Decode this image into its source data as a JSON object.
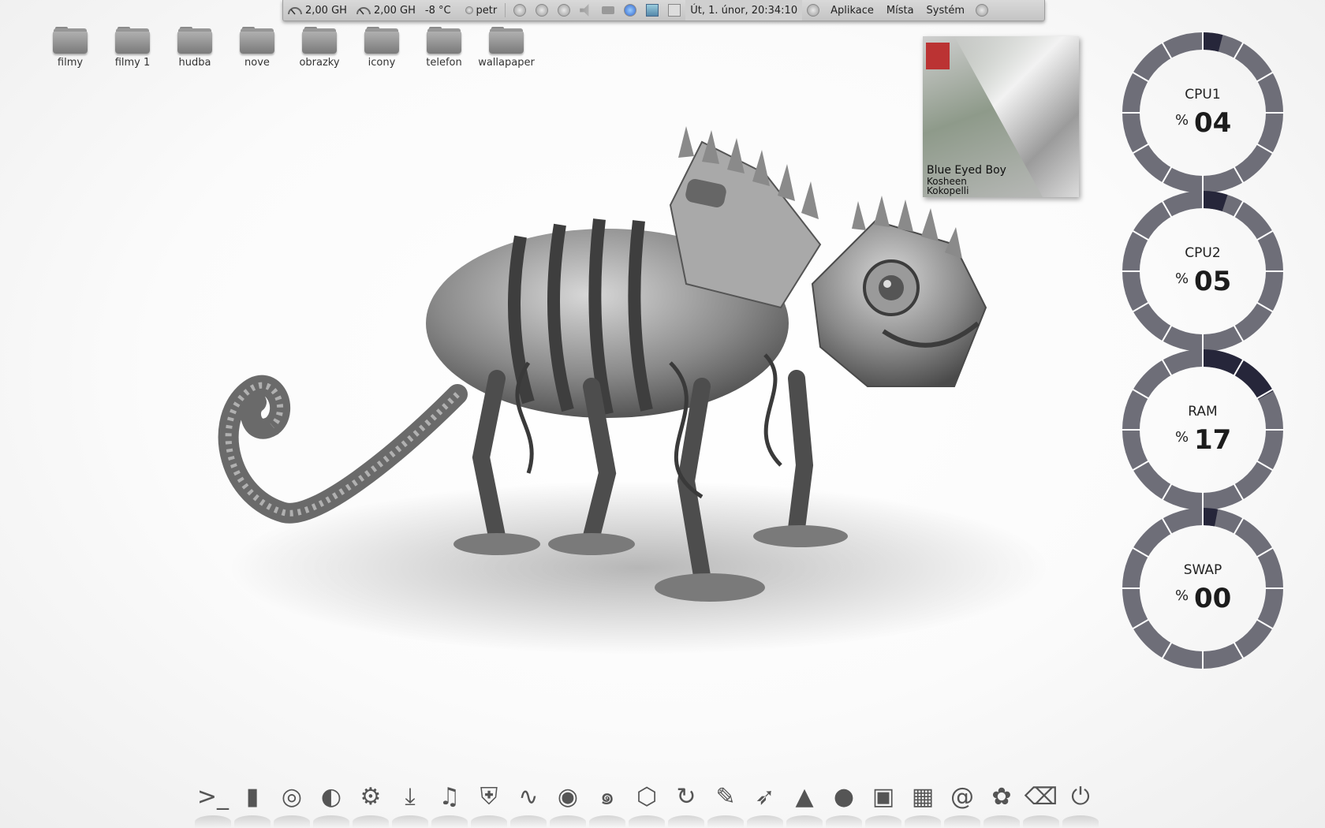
{
  "top_panel": {
    "cpu_freq_1": "2,00 GH",
    "cpu_freq_2": "2,00 GH",
    "temperature": "-8 °C",
    "user": "petr",
    "clock": "Út,  1. únor, 20:34:10",
    "menu_apps": "Aplikace",
    "menu_places": "Místa",
    "menu_system": "Systém"
  },
  "desktop_icons": [
    {
      "label": "filmy"
    },
    {
      "label": "filmy 1"
    },
    {
      "label": "hudba"
    },
    {
      "label": "nove"
    },
    {
      "label": "obrazky"
    },
    {
      "label": "icony"
    },
    {
      "label": "telefon"
    },
    {
      "label": "wallapaper"
    }
  ],
  "album": {
    "song": "Blue Eyed Boy",
    "artist": "Kosheen",
    "album": "Kokopelli"
  },
  "monitors": [
    {
      "label": "CPU1",
      "value": "04",
      "percent_symbol": "%",
      "fraction": 0.04
    },
    {
      "label": "CPU2",
      "value": "05",
      "percent_symbol": "%",
      "fraction": 0.05
    },
    {
      "label": "RAM",
      "value": "17",
      "percent_symbol": "%",
      "fraction": 0.17
    },
    {
      "label": "SWAP",
      "value": "00",
      "percent_symbol": "%",
      "fraction": 0.03
    }
  ],
  "colors": {
    "ring_base": "#6e6e78",
    "ring_active": "#26263a"
  },
  "dock_icons": [
    {
      "name": "terminal-icon",
      "glyph": ">_"
    },
    {
      "name": "file-manager-icon",
      "glyph": "▮"
    },
    {
      "name": "chrome-icon",
      "glyph": "◎"
    },
    {
      "name": "firefox-icon",
      "glyph": "◐"
    },
    {
      "name": "settings-gear-icon",
      "glyph": "⚙"
    },
    {
      "name": "download-icon",
      "glyph": "⤓"
    },
    {
      "name": "music-player-icon",
      "glyph": "♫"
    },
    {
      "name": "shield-icon",
      "glyph": "⛨"
    },
    {
      "name": "system-monitor-icon",
      "glyph": "∿"
    },
    {
      "name": "media-icon",
      "glyph": "◉"
    },
    {
      "name": "swirl-icon",
      "glyph": "๑"
    },
    {
      "name": "cube-icon",
      "glyph": "⬡"
    },
    {
      "name": "refresh-icon",
      "glyph": "↻"
    },
    {
      "name": "pencil-icon",
      "glyph": "✎"
    },
    {
      "name": "cursor-icon",
      "glyph": "➶"
    },
    {
      "name": "cone-icon",
      "glyph": "▲"
    },
    {
      "name": "browser-globe-icon",
      "glyph": "●"
    },
    {
      "name": "window-switcher-icon",
      "glyph": "▣"
    },
    {
      "name": "workspace-switcher-icon",
      "glyph": "▦"
    },
    {
      "name": "email-icon",
      "glyph": "@"
    },
    {
      "name": "gnome-foot-icon",
      "glyph": "✿"
    },
    {
      "name": "trash-icon",
      "glyph": "⌫"
    },
    {
      "name": "power-icon",
      "glyph": "⏻"
    }
  ]
}
